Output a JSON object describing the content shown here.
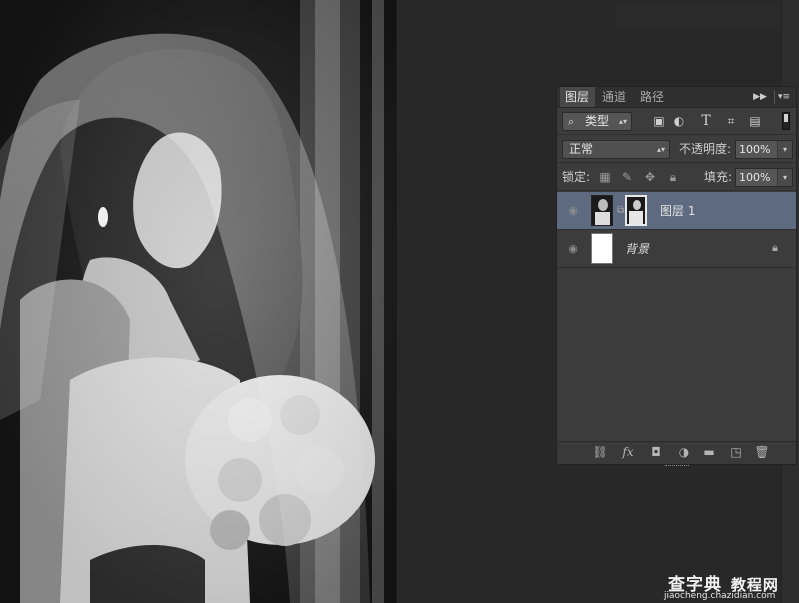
{
  "colors": {
    "app_background": "#282828",
    "panel_background": "#3c3c3c",
    "selected_layer": "#5d6a80",
    "tab_active": "#484848"
  },
  "panel": {
    "tabs": [
      {
        "label": "图层",
        "active": true
      },
      {
        "label": "通道",
        "active": false
      },
      {
        "label": "路径",
        "active": false
      }
    ],
    "collapse_icon": "double-chevron-right-icon",
    "menu_icon": "panel-menu-icon",
    "filter": {
      "selected": "类型",
      "icons": [
        "image-filter-icon",
        "adjustment-filter-icon",
        "type-filter-icon",
        "shape-filter-icon",
        "smart-object-filter-icon"
      ]
    },
    "blend": {
      "mode": "正常",
      "opacity_label": "不透明度:",
      "opacity_value": "100%"
    },
    "lock": {
      "label": "锁定:",
      "icons": [
        "lock-transparent-icon",
        "lock-pixels-icon",
        "lock-position-icon",
        "lock-all-icon"
      ],
      "fill_label": "填充:",
      "fill_value": "100%"
    },
    "layers": [
      {
        "name": "图层 1",
        "visible": true,
        "selected": true,
        "has_mask": true,
        "locked": false
      },
      {
        "name": "背景",
        "visible": true,
        "selected": false,
        "has_mask": false,
        "locked": true
      }
    ],
    "bottom_icons": [
      "link-layers-icon",
      "fx-icon",
      "add-mask-icon",
      "adjustment-layer-icon",
      "new-group-icon",
      "new-layer-icon",
      "trash-icon"
    ],
    "fx_label": "fx"
  },
  "watermark": {
    "brand": "查字典",
    "sub": "教程网",
    "url": "jiaocheng.chazidian.com"
  }
}
